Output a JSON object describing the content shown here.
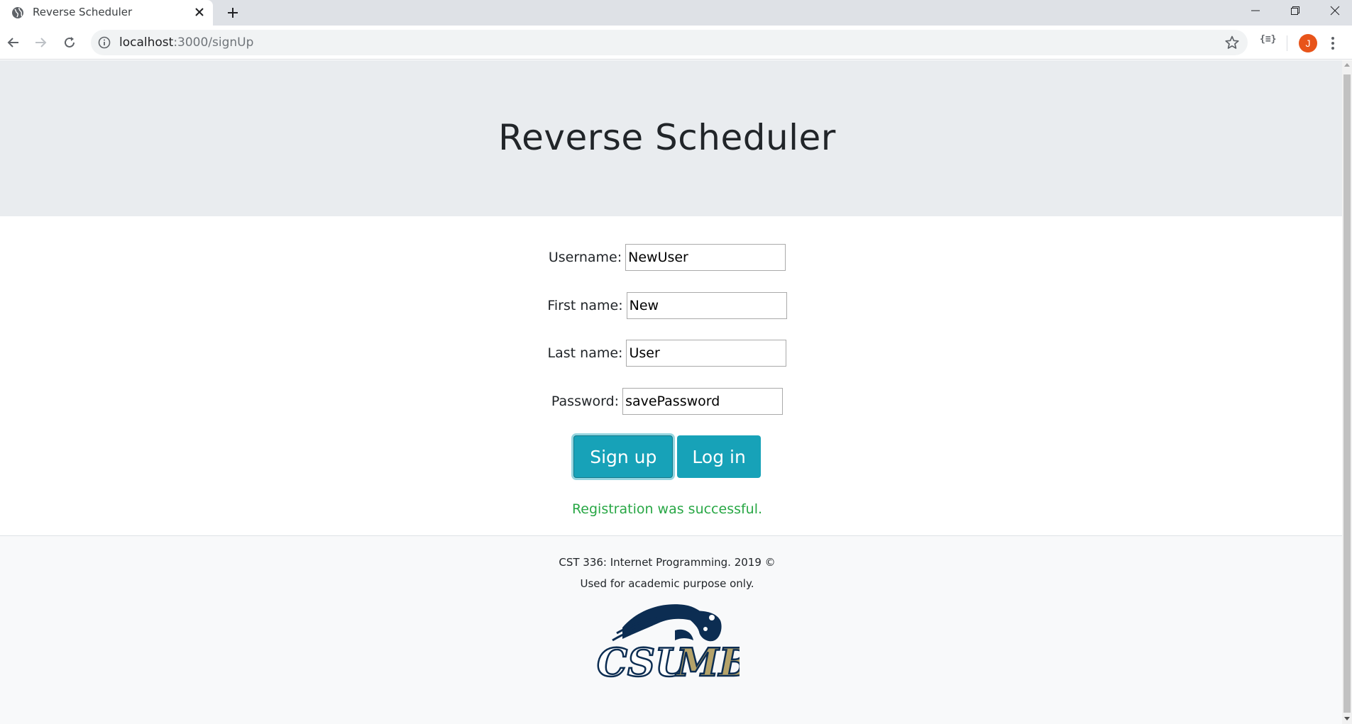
{
  "browser": {
    "tab_title": "Reverse Scheduler",
    "url_host": "localhost",
    "url_path": ":3000/signUp",
    "extension_label": "{≡}",
    "profile_initial": "J",
    "profile_color": "#e8541a"
  },
  "page": {
    "title": "Reverse Scheduler",
    "form": {
      "username_label": "Username:",
      "username_value": "NewUser",
      "firstname_label": "First name:",
      "firstname_value": "New",
      "lastname_label": "Last name:",
      "lastname_value": "User",
      "password_label": "Password:",
      "password_value": "savePassword"
    },
    "buttons": {
      "signup_label": "Sign up",
      "login_label": "Log in"
    },
    "message": "Registration was successful.",
    "footer": {
      "line1": "CST 336: Internet Programming. 2019 ©",
      "line2": "Used for academic purpose only.",
      "logo_text": "CSUMB"
    }
  },
  "colors": {
    "accent": "#17a2b8",
    "success": "#28a745",
    "jumbotron": "#e9ecef"
  }
}
